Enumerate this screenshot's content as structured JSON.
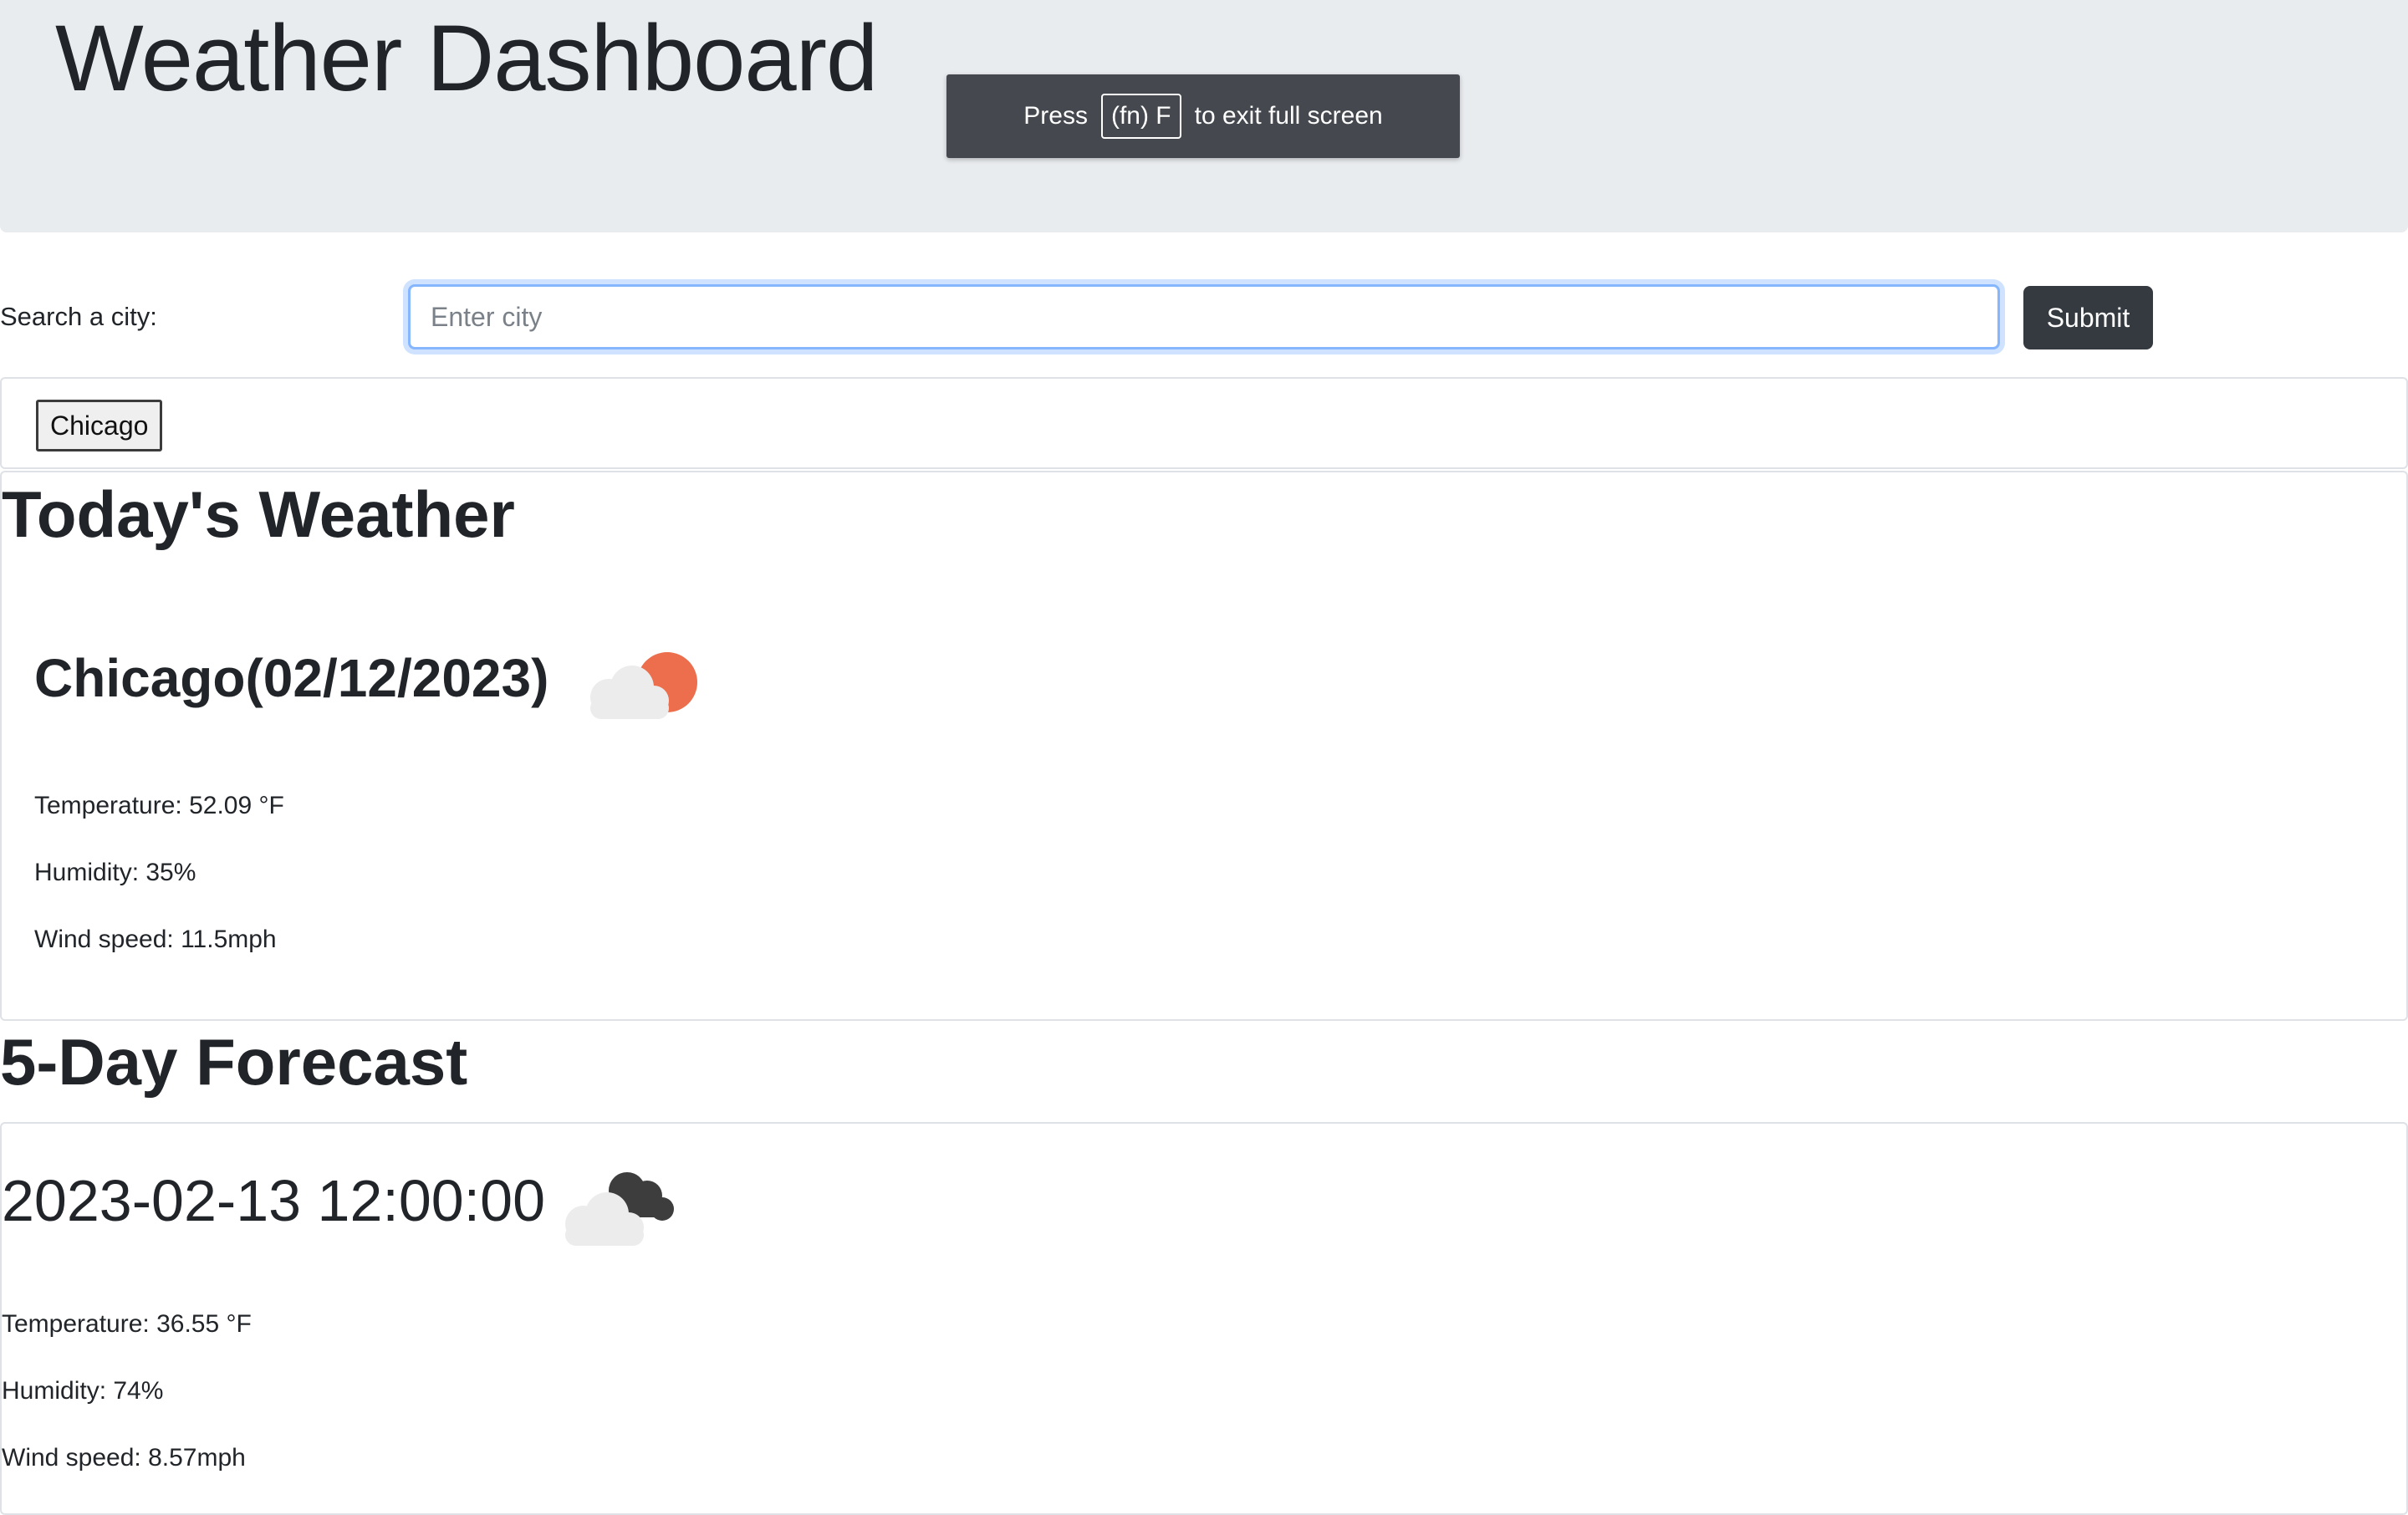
{
  "header": {
    "title": "Weather Dashboard"
  },
  "fullscreen_toast": {
    "press": "Press",
    "key": "(fn) F",
    "suffix": "to exit full screen"
  },
  "search": {
    "label": "Search a city:",
    "placeholder": "Enter city",
    "value": "",
    "submit_label": "Submit"
  },
  "history": {
    "items": [
      "Chicago"
    ]
  },
  "today": {
    "section_title": "Today's Weather",
    "city_heading": "Chicago(02/12/2023)",
    "icon": "partly-cloudy-day-icon",
    "temperature": "Temperature: 52.09 °F",
    "humidity": "Humidity: 35%",
    "wind": "Wind speed: 11.5mph"
  },
  "forecast": {
    "section_title": "5-Day Forecast",
    "days": [
      {
        "date": "2023-02-13 12:00:00",
        "icon": "broken-clouds-icon",
        "temperature": "Temperature: 36.55 °F",
        "humidity": "Humidity: 74%",
        "wind": "Wind speed: 8.57mph"
      }
    ]
  },
  "colors": {
    "header_bg": "#e9ecef",
    "submit_bg": "#343a40",
    "input_focus": "#86b7fe",
    "sun": "#ec6e4c",
    "cloud_light": "#ececec",
    "cloud_dark": "#3d3d3d"
  }
}
